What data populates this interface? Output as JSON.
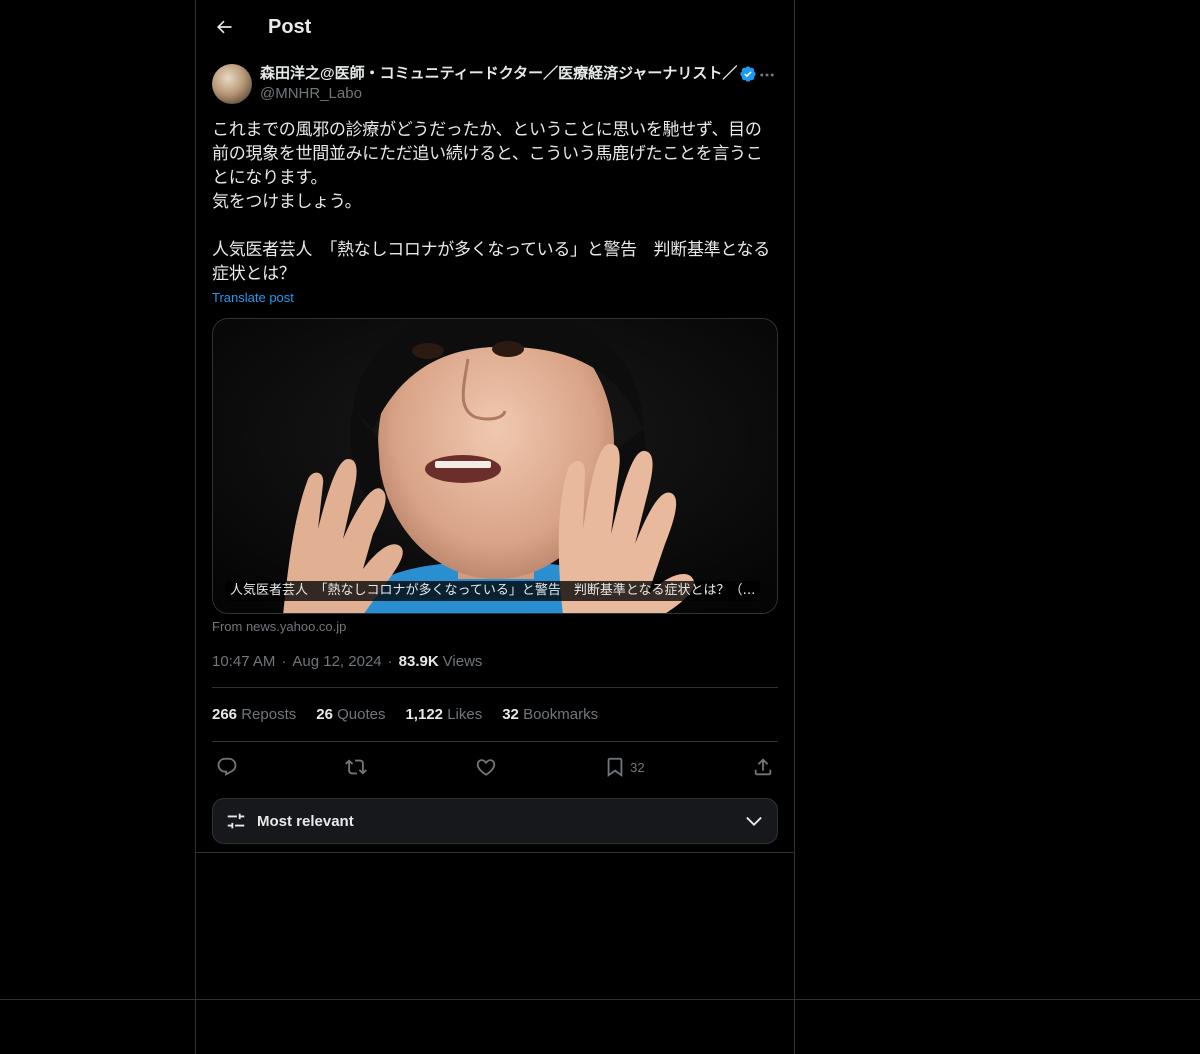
{
  "header": {
    "title": "Post"
  },
  "author": {
    "display_name": "森田洋之@医師・コミュニティードクター／医療経済ジャーナリスト／",
    "handle": "@MNHR_Labo"
  },
  "post": {
    "text": "これまでの風邪の診療がどうだったか、ということに思いを馳せず、目の前の現象を世間並みにただ追い続けると、こういう馬鹿げたことを言うことになります。\n気をつけましょう。\n\n人気医者芸人　「熱なしコロナが多くなっている」と警告　判断基準となる症状とは？",
    "translate_label": "Translate post"
  },
  "card": {
    "caption": "人気医者芸人　「熱なしコロナが多くなっている」と警告　判断基準となる症状とは？（…",
    "source": "From news.yahoo.co.jp"
  },
  "meta": {
    "time": "10:47 AM",
    "date": "Aug 12, 2024",
    "views_count": "83.9K",
    "views_label": "Views"
  },
  "stats": {
    "reposts": {
      "count": "266",
      "label": "Reposts"
    },
    "quotes": {
      "count": "26",
      "label": "Quotes"
    },
    "likes": {
      "count": "1,122",
      "label": "Likes"
    },
    "bookmarks": {
      "count": "32",
      "label": "Bookmarks"
    }
  },
  "actions": {
    "bookmark_count": "32"
  },
  "sort": {
    "label": "Most relevant"
  },
  "colors": {
    "background": "#000000",
    "text": "#e7e9ea",
    "muted": "#71767b",
    "accent": "#1d9bf0",
    "border": "#2f3336"
  }
}
